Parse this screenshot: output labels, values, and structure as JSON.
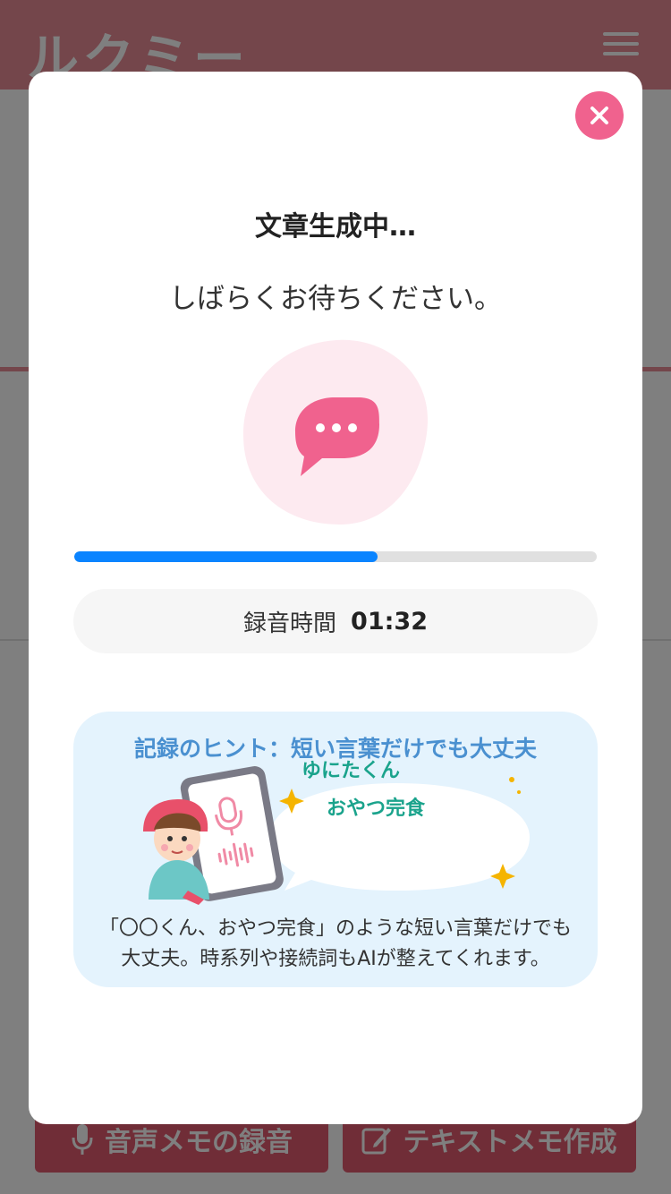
{
  "app": {
    "logo_text": "ルクミー"
  },
  "bottom_buttons": {
    "voice_memo": "音声メモの録音",
    "text_memo": "テキストメモ作成"
  },
  "modal": {
    "title": "文章生成中…",
    "subtitle": "しばらくお待ちください。",
    "progress": 0.58,
    "recording": {
      "label": "録音時間",
      "time": "01:32"
    },
    "hint": {
      "title": "記録のヒント：短い言葉だけでも大丈夫",
      "bubble_line1": "ゆにたくん",
      "bubble_line2": "おやつ完食",
      "body": "「〇〇くん、おやつ完食」のような短い言葉だけでも大丈夫。時系列や接続詞もAIが整えてくれます。"
    }
  },
  "colors": {
    "accent_pink": "#f0628e",
    "progress_blue": "#0a84ff",
    "hint_blue": "#4a90d0",
    "bubble_green": "#1aa38c"
  },
  "icons": [
    "menu-icon",
    "close-icon",
    "chat-bubble-icon",
    "microphone-icon",
    "edit-icon"
  ]
}
